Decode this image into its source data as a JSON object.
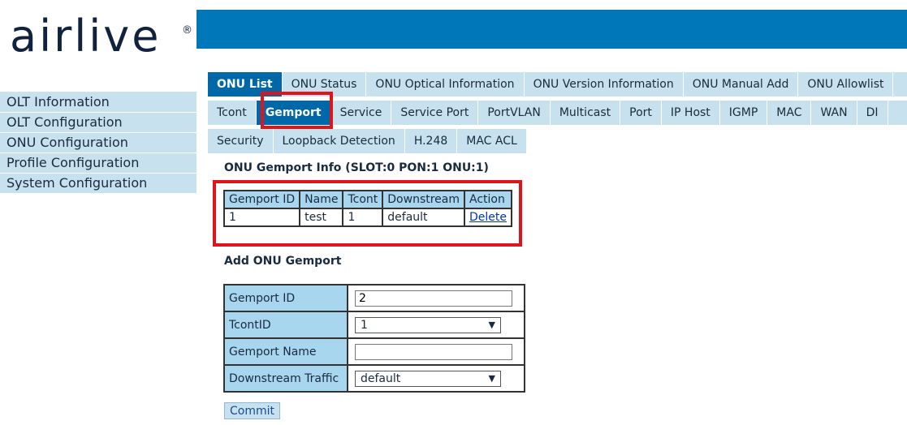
{
  "logo": {
    "text": "airlive",
    "mark": "®"
  },
  "sidebar": {
    "items": [
      {
        "label": "OLT Information"
      },
      {
        "label": "OLT Configuration"
      },
      {
        "label": "ONU Configuration"
      },
      {
        "label": "Profile Configuration"
      },
      {
        "label": "System Configuration"
      }
    ]
  },
  "tabs": {
    "row1": [
      "ONU List",
      "ONU Status",
      "ONU Optical Information",
      "ONU Version Information",
      "ONU Manual Add",
      "ONU Allowlist"
    ],
    "row1_active": "ONU List",
    "row2": [
      "Tcont",
      "Gemport",
      "Service",
      "Service Port",
      "PortVLAN",
      "Multicast",
      "Port",
      "IP Host",
      "IGMP",
      "MAC",
      "WAN",
      "DI"
    ],
    "row2_active": "Gemport",
    "row3": [
      "Security",
      "Loopback Detection",
      "H.248",
      "MAC ACL"
    ]
  },
  "info": {
    "title": "ONU Gemport Info (SLOT:0 PON:1 ONU:1)",
    "headers": [
      "Gemport ID",
      "Name",
      "Tcont",
      "Downstream",
      "Action"
    ],
    "row": {
      "gemport_id": "1",
      "name": "test",
      "tcont": "1",
      "downstream": "default",
      "action": "Delete"
    }
  },
  "add": {
    "title": "Add ONU Gemport",
    "gemport_id_label": "Gemport ID",
    "gemport_id_value": "2",
    "tcont_label": "TcontID",
    "tcont_value": "1",
    "name_label": "Gemport Name",
    "name_value": "",
    "downstream_label": "Downstream Traffic",
    "downstream_value": "default",
    "commit_label": "Commit"
  },
  "colors": {
    "banner": "#0077b8",
    "tab_active": "#0067a8",
    "highlight": "#e0141b",
    "header_cell": "#a8d6ee"
  }
}
